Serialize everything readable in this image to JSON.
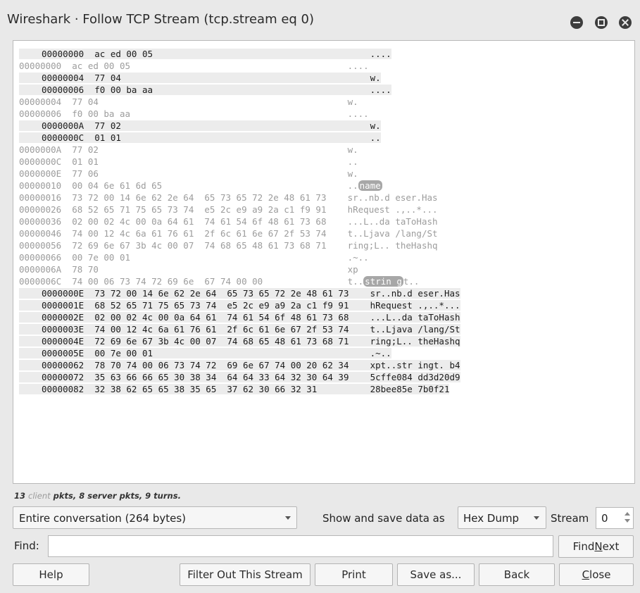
{
  "window": {
    "title": "Wireshark · Follow TCP Stream (tcp.stream eq 0)"
  },
  "stream_lines": [
    {
      "dir": "server",
      "offset": "00000000",
      "hex": "ac ed 00 05",
      "ascii": "...."
    },
    {
      "dir": "client",
      "offset": "00000000",
      "hex": "ac ed 00 05",
      "ascii": "...."
    },
    {
      "dir": "server",
      "offset": "00000004",
      "hex": "77 04",
      "ascii": "w."
    },
    {
      "dir": "server",
      "offset": "00000006",
      "hex": "f0 00 ba aa",
      "ascii": "...."
    },
    {
      "dir": "client",
      "offset": "00000004",
      "hex": "77 04",
      "ascii": "w."
    },
    {
      "dir": "client",
      "offset": "00000006",
      "hex": "f0 00 ba aa",
      "ascii": "...."
    },
    {
      "dir": "server",
      "offset": "0000000A",
      "hex": "77 02",
      "ascii": "w."
    },
    {
      "dir": "server",
      "offset": "0000000C",
      "hex": "01 01",
      "ascii": ".."
    },
    {
      "dir": "client",
      "offset": "0000000A",
      "hex": "77 02",
      "ascii": "w."
    },
    {
      "dir": "client",
      "offset": "0000000C",
      "hex": "01 01",
      "ascii": ".."
    },
    {
      "dir": "client",
      "offset": "0000000E",
      "hex": "77 06",
      "ascii": "w."
    },
    {
      "dir": "client",
      "offset": "00000010",
      "hex": "00 04 6e 61 6d 65",
      "ascii": "..",
      "hl": "name",
      "ascii_after": ""
    },
    {
      "dir": "client",
      "offset": "00000016",
      "hex": "73 72 00 14 6e 62 2e 64  65 73 65 72 2e 48 61 73",
      "ascii": "sr..nb.d eser.Has"
    },
    {
      "dir": "client",
      "offset": "00000026",
      "hex": "68 52 65 71 75 65 73 74  e5 2c e9 a9 2a c1 f9 91",
      "ascii": "hRequest .,..*..."
    },
    {
      "dir": "client",
      "offset": "00000036",
      "hex": "02 00 02 4c 00 0a 64 61  74 61 54 6f 48 61 73 68",
      "ascii": "...L..da taToHash"
    },
    {
      "dir": "client",
      "offset": "00000046",
      "hex": "74 00 12 4c 6a 61 76 61  2f 6c 61 6e 67 2f 53 74",
      "ascii": "t..Ljava /lang/St"
    },
    {
      "dir": "client",
      "offset": "00000056",
      "hex": "72 69 6e 67 3b 4c 00 07  74 68 65 48 61 73 68 71",
      "ascii": "ring;L.. theHashq"
    },
    {
      "dir": "client",
      "offset": "00000066",
      "hex": "00 7e 00 01",
      "ascii": ".~.."
    },
    {
      "dir": "client",
      "offset": "0000006A",
      "hex": "78 70",
      "ascii": "xp"
    },
    {
      "dir": "client",
      "offset": "0000006C",
      "hex": "74 00 06 73 74 72 69 6e  67 74 00 00",
      "ascii": "t..",
      "hl": "strin g",
      "ascii_after": "t.."
    },
    {
      "dir": "server",
      "offset": "0000000E",
      "hex": "73 72 00 14 6e 62 2e 64  65 73 65 72 2e 48 61 73",
      "ascii": "sr..nb.d eser.Has"
    },
    {
      "dir": "server",
      "offset": "0000001E",
      "hex": "68 52 65 71 75 65 73 74  e5 2c e9 a9 2a c1 f9 91",
      "ascii": "hRequest .,..*..."
    },
    {
      "dir": "server",
      "offset": "0000002E",
      "hex": "02 00 02 4c 00 0a 64 61  74 61 54 6f 48 61 73 68",
      "ascii": "...L..da taToHash"
    },
    {
      "dir": "server",
      "offset": "0000003E",
      "hex": "74 00 12 4c 6a 61 76 61  2f 6c 61 6e 67 2f 53 74",
      "ascii": "t..Ljava /lang/St"
    },
    {
      "dir": "server",
      "offset": "0000004E",
      "hex": "72 69 6e 67 3b 4c 00 07  74 68 65 48 61 73 68 71",
      "ascii": "ring;L.. theHashq"
    },
    {
      "dir": "server",
      "offset": "0000005E",
      "hex": "00 7e 00 01",
      "ascii": ".~.."
    },
    {
      "dir": "server",
      "offset": "00000062",
      "hex": "78 70 74 00 06 73 74 72  69 6e 67 74 00 20 62 34",
      "ascii": "xpt..str ingt. b4"
    },
    {
      "dir": "server",
      "offset": "00000072",
      "hex": "35 63 66 66 65 30 38 34  64 64 33 64 32 30 64 39",
      "ascii": "5cffe084 dd3d20d9"
    },
    {
      "dir": "server",
      "offset": "00000082",
      "hex": "32 38 62 65 65 38 35 65  37 62 30 66 32 31",
      "ascii": "28bee85e 7b0f21"
    }
  ],
  "summary": {
    "count1": "13",
    "client_word": "client",
    "text1": "pkts, 8",
    "server_word": "server",
    "text2": "pkts, 9 turns."
  },
  "controls": {
    "conversation": "Entire conversation (264 bytes)",
    "show_label": "Show and save data as",
    "format": "Hex Dump",
    "stream_label": "Stream",
    "stream_value": "0",
    "find_label": "Find:",
    "find_value": "",
    "find_next": "Find Next"
  },
  "buttons": {
    "help": "Help",
    "filter_out": "Filter Out This Stream",
    "print": "Print",
    "save_as": "Save as...",
    "back": "Back",
    "close": "Close"
  },
  "colors": {
    "client_text": "#9c9c9c",
    "server_text": "#1a1a1a",
    "server_bg": "#ececec",
    "highlight": "#a7a7a7"
  }
}
